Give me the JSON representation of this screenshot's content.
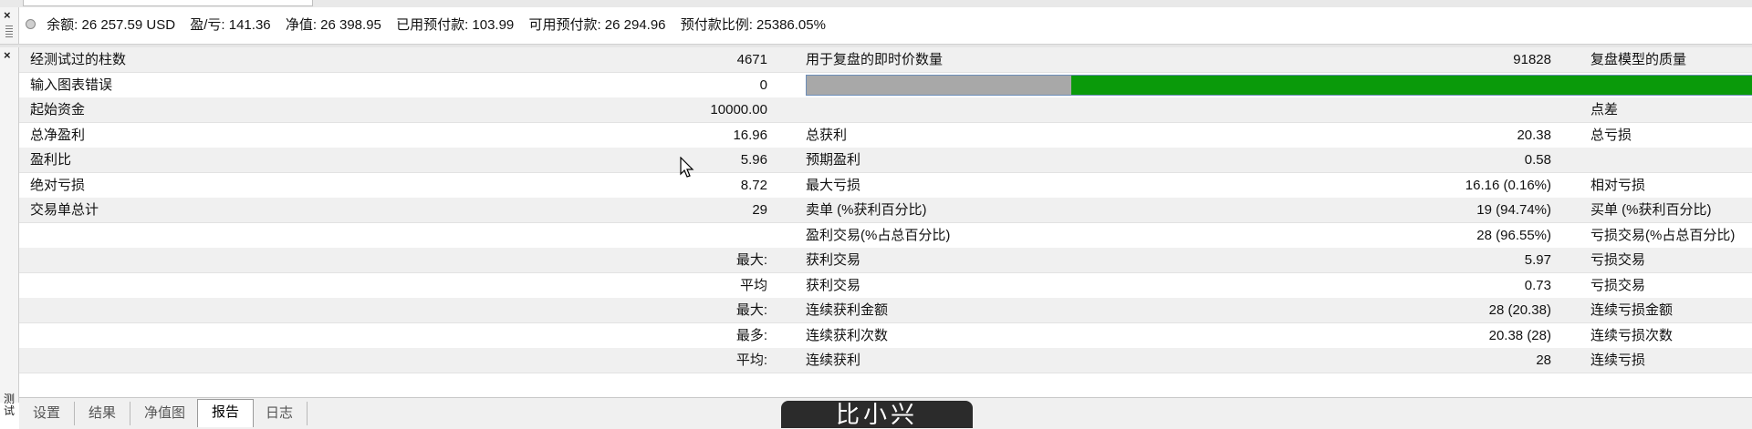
{
  "account": {
    "items": [
      "余额: 26 257.59 USD",
      "盈/亏: 141.36",
      "净值: 26 398.95",
      "已用预付款: 103.99",
      "可用预付款: 26 294.96",
      "预付款比例: 25386.05%"
    ]
  },
  "report": {
    "rows": [
      {
        "c1": "经测试过的柱数",
        "c2": "4671",
        "c3": "用于复盘的即时价数量",
        "c4": "91828",
        "c5": "复盘模型的质量"
      },
      {
        "c1": "输入图表错误",
        "c2": "0",
        "c3": "",
        "c4": "",
        "c5": ""
      },
      {
        "c1": "起始资金",
        "c2": "10000.00",
        "c3": "",
        "c4": "",
        "c5": "点差"
      },
      {
        "c1": "总净盈利",
        "c2": "16.96",
        "c3": "总获利",
        "c4": "20.38",
        "c5": "总亏损"
      },
      {
        "c1": "盈利比",
        "c2": "5.96",
        "c3": "预期盈利",
        "c4": "0.58",
        "c5": ""
      },
      {
        "c1": "绝对亏损",
        "c2": "8.72",
        "c3": "最大亏损",
        "c4": "16.16 (0.16%)",
        "c5": "相对亏损"
      },
      {
        "c1": "交易单总计",
        "c2": "29",
        "c3": "卖单 (%获利百分比)",
        "c4": "19 (94.74%)",
        "c5": "买单 (%获利百分比)"
      },
      {
        "c1": "",
        "c2": "",
        "c3": "盈利交易(%占总百分比)",
        "c4": "28 (96.55%)",
        "c5": "亏损交易(%占总百分比)"
      },
      {
        "c1": "",
        "c2": "最大:",
        "c3": "获利交易",
        "c4": "5.97",
        "c5": "亏损交易"
      },
      {
        "c1": "",
        "c2": "平均",
        "c3": "获利交易",
        "c4": "0.73",
        "c5": "亏损交易"
      },
      {
        "c1": "",
        "c2": "最大:",
        "c3": "连续获利金额",
        "c4": "28 (20.38)",
        "c5": "连续亏损金额"
      },
      {
        "c1": "",
        "c2": "最多:",
        "c3": "连续获利次数",
        "c4": "20.38 (28)",
        "c5": "连续亏损次数"
      },
      {
        "c1": "",
        "c2": "平均:",
        "c3": "连续获利",
        "c4": "28",
        "c5": "连续亏损"
      }
    ],
    "quality_bar": {
      "gray_fraction": 0.28,
      "gray_color": "#a8a8a8",
      "green_color": "#0a9a0a"
    }
  },
  "tabs": [
    {
      "label": "设置",
      "active": false
    },
    {
      "label": "结果",
      "active": false
    },
    {
      "label": "净值图",
      "active": false
    },
    {
      "label": "报告",
      "active": true
    },
    {
      "label": "日志",
      "active": false
    }
  ],
  "side_label": "测试",
  "overlay_text": "比小兴"
}
